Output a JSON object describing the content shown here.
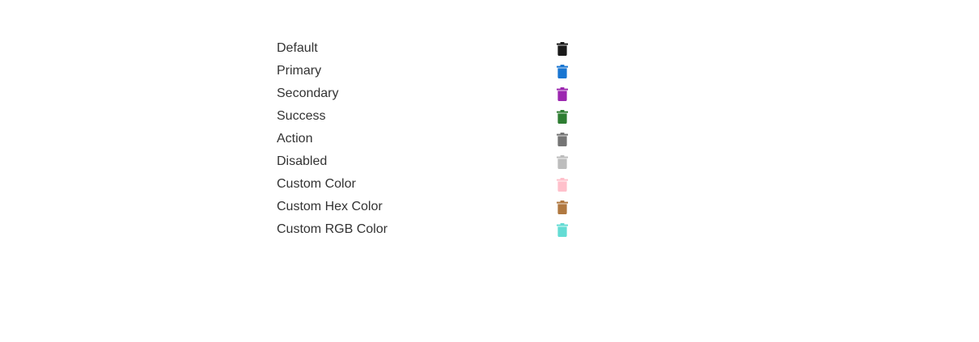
{
  "rows": [
    {
      "label": "Default",
      "icon": "trash-icon",
      "color": "#1a1a1a"
    },
    {
      "label": "Primary",
      "icon": "trash-icon",
      "color": "#1976d2"
    },
    {
      "label": "Secondary",
      "icon": "trash-icon",
      "color": "#9c27b0"
    },
    {
      "label": "Success",
      "icon": "trash-icon",
      "color": "#2e7d32"
    },
    {
      "label": "Action",
      "icon": "trash-icon",
      "color": "#757575"
    },
    {
      "label": "Disabled",
      "icon": "trash-icon",
      "color": "#bdbdbd"
    },
    {
      "label": "Custom Color",
      "icon": "trash-icon",
      "color": "#ffc0cb"
    },
    {
      "label": "Custom Hex Color",
      "icon": "trash-icon",
      "color": "#b07840"
    },
    {
      "label": "Custom RGB Color",
      "icon": "trash-icon",
      "color": "#64dcd4"
    }
  ]
}
